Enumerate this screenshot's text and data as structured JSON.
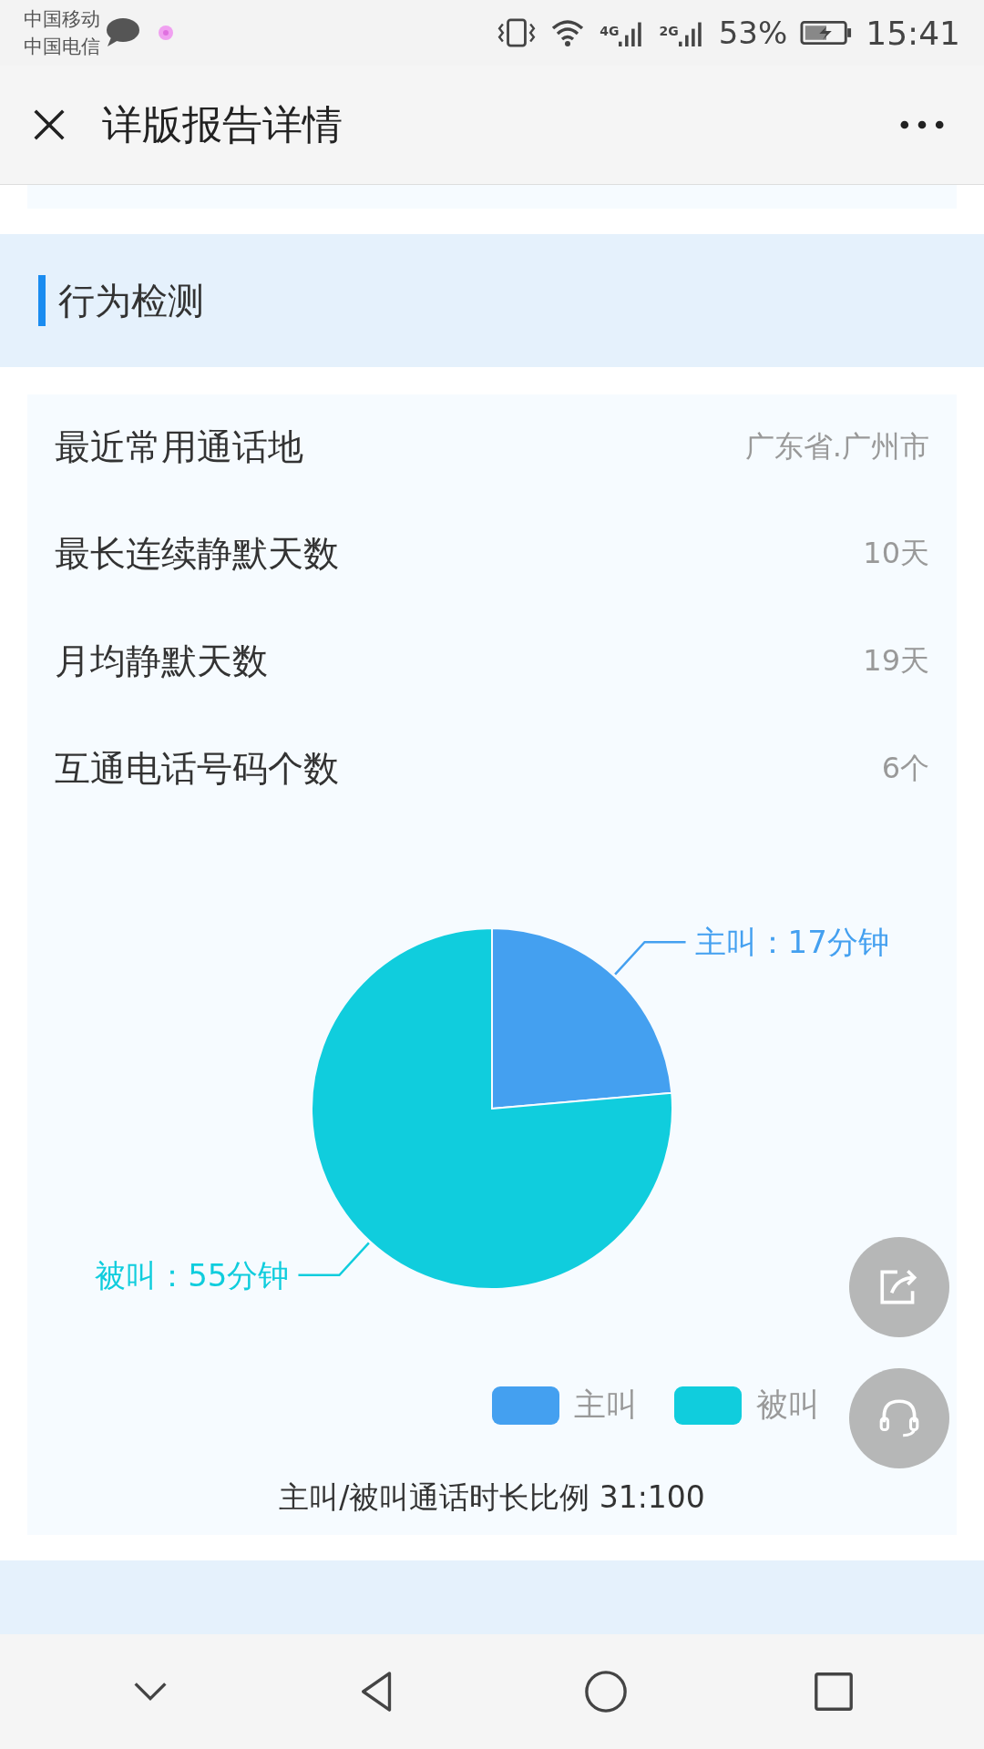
{
  "status_bar": {
    "carriers": [
      "中国移动",
      "中国电信"
    ],
    "battery": "53%",
    "time": "15:41",
    "network_1": "4G",
    "network_2": "2G"
  },
  "header": {
    "title": "详版报告详情"
  },
  "section": {
    "title": "行为检测"
  },
  "rows": [
    {
      "label": "最近常用通话地",
      "value": "广东省.广州市"
    },
    {
      "label": "最长连续静默天数",
      "value": "10天"
    },
    {
      "label": "月均静默天数",
      "value": "19天"
    },
    {
      "label": "互通电话号码个数",
      "value": "6个"
    }
  ],
  "chart_data": {
    "type": "pie",
    "categories": [
      "主叫",
      "被叫"
    ],
    "values": [
      17,
      55
    ],
    "colors": [
      "#44a0f0",
      "#10cddd"
    ],
    "legend": "bottom-right",
    "value_labels": [
      "主叫：17分钟",
      "被叫：55分钟"
    ]
  },
  "ratio_text": "主叫/被叫通话时长比例 31:100"
}
